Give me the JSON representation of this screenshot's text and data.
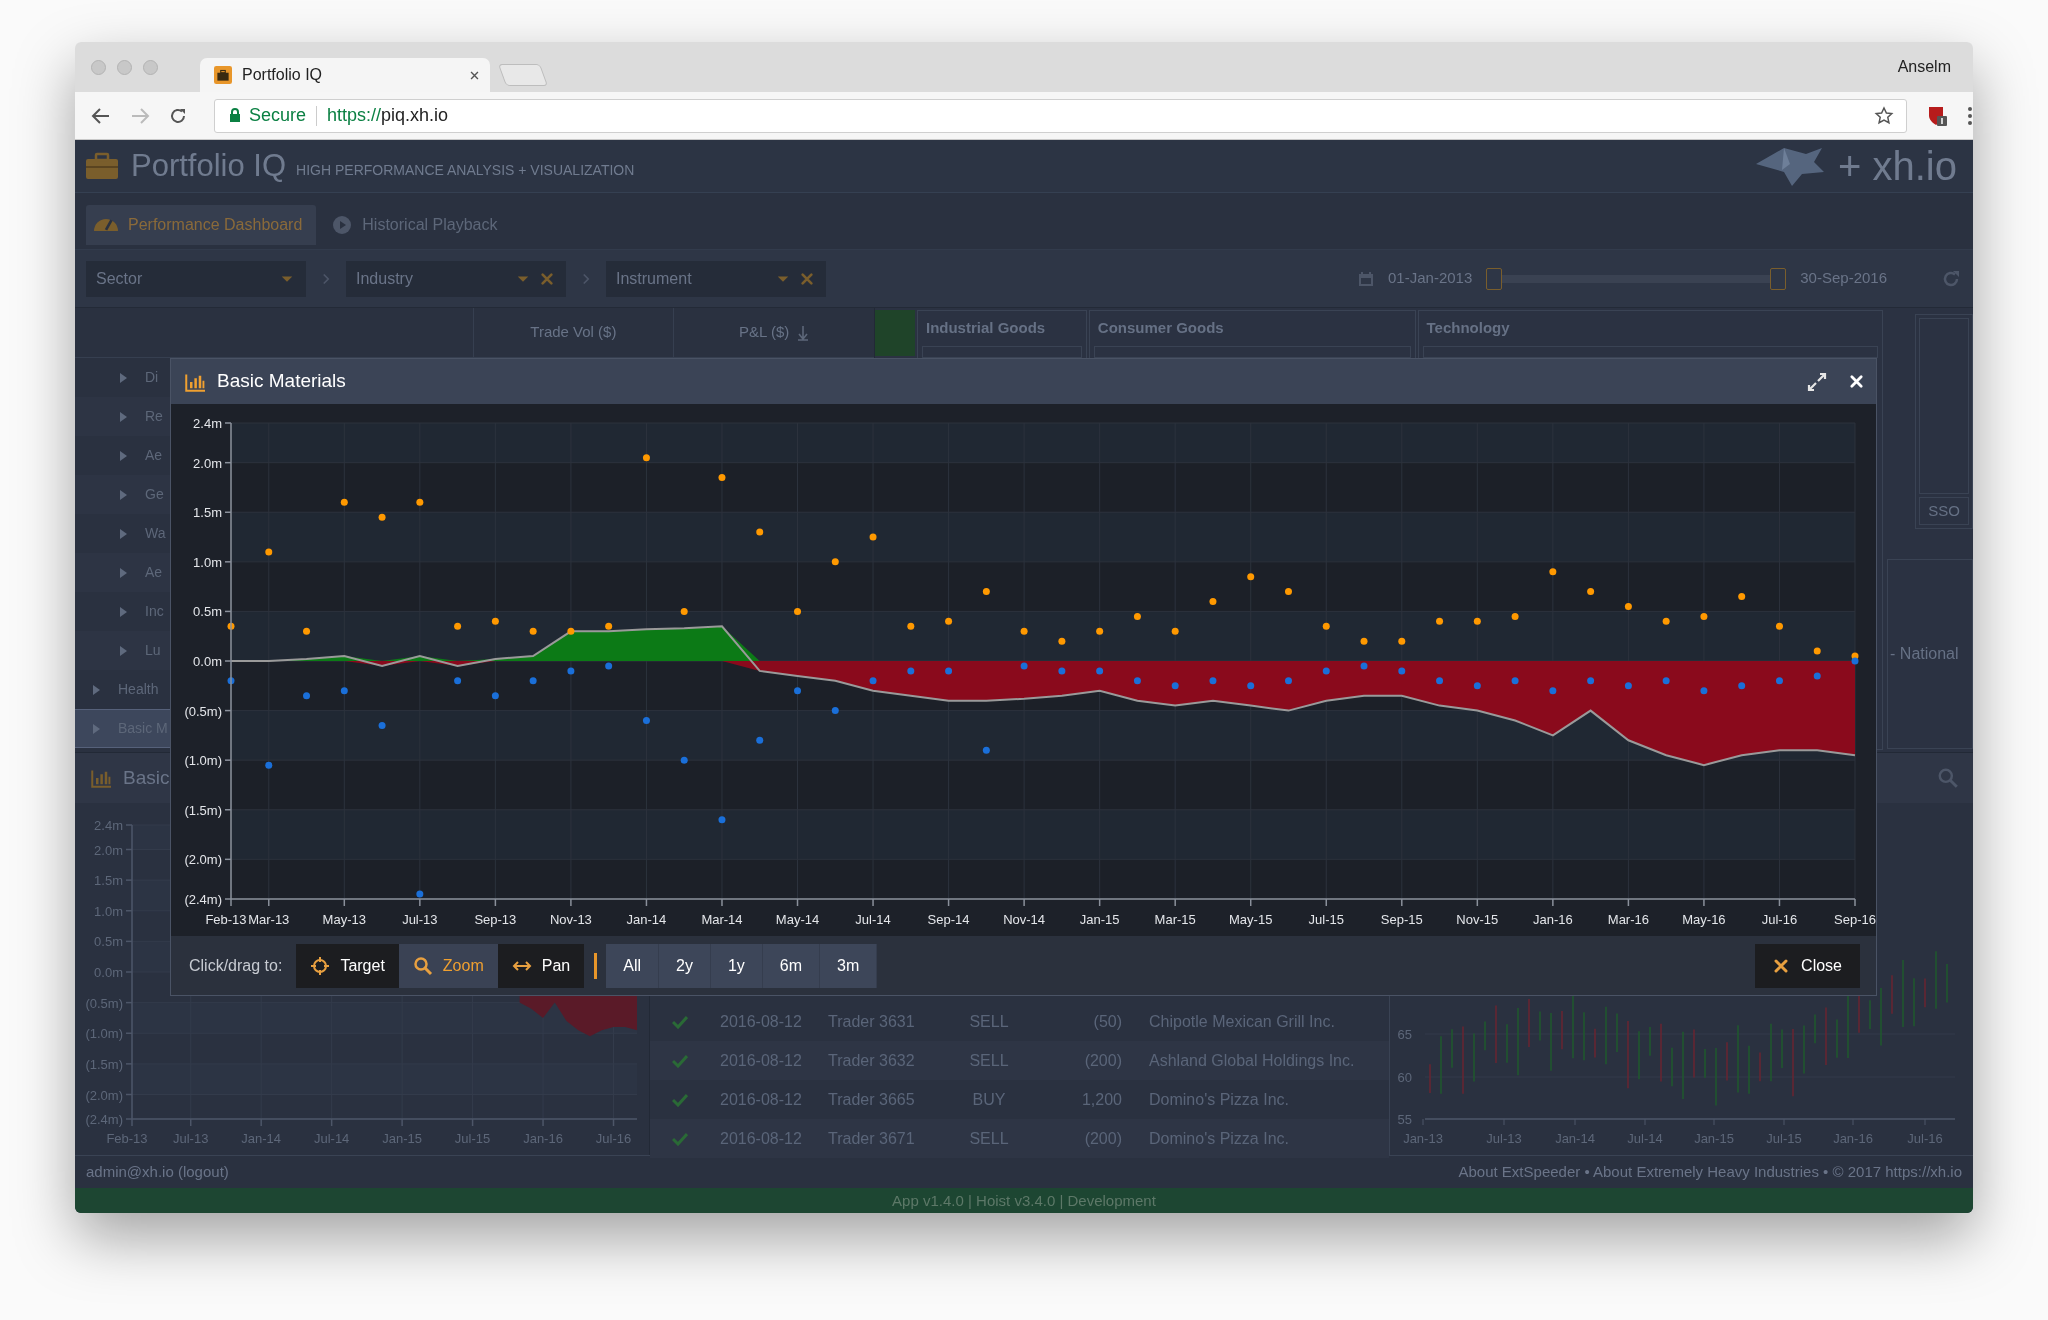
{
  "browser": {
    "tab_title": "Portfolio IQ",
    "profile": "Anselm",
    "security_label": "Secure",
    "url_scheme": "https://",
    "url_host": "piq.xh.io"
  },
  "app": {
    "title": "Portfolio IQ",
    "subtitle": "HIGH PERFORMANCE ANALYSIS + VISUALIZATION",
    "brand": "+ xh.io"
  },
  "nav_tabs": [
    {
      "label": "Performance Dashboard",
      "selected": true
    },
    {
      "label": "Historical Playback",
      "selected": false
    }
  ],
  "filters": [
    {
      "label": "Sector",
      "clearable": false
    },
    {
      "label": "Industry",
      "clearable": true
    },
    {
      "label": "Instrument",
      "clearable": true
    }
  ],
  "date_range": {
    "start": "01-Jan-2013",
    "end": "30-Sep-2016",
    "handles": [
      {
        "level": 0
      },
      {
        "level": 1
      }
    ]
  },
  "grid": {
    "columns": [
      "Trade Vol ($)",
      "P&L ($)"
    ],
    "rows": [
      {
        "label": "Di",
        "kind": "leaf",
        "selected": false
      },
      {
        "label": "Re",
        "kind": "leaf",
        "selected": false
      },
      {
        "label": "Ae",
        "kind": "leaf",
        "selected": false
      },
      {
        "label": "Ge",
        "kind": "leaf",
        "selected": false
      },
      {
        "label": "Wa",
        "kind": "leaf",
        "selected": false
      },
      {
        "label": "Ae",
        "kind": "leaf",
        "selected": false
      },
      {
        "label": "Inc",
        "kind": "leaf",
        "selected": false
      },
      {
        "label": "Lu",
        "kind": "leaf",
        "selected": false
      },
      {
        "label": "Health",
        "kind": "group",
        "selected": false
      },
      {
        "label": "Basic M",
        "kind": "group",
        "selected": true
      }
    ]
  },
  "treemap": {
    "groups": [
      "Industrial Goods",
      "Consumer Goods",
      "Technology"
    ],
    "cells": [
      "SSO",
      "- National"
    ]
  },
  "modal": {
    "title": "Basic Materials",
    "chart_data": {
      "type": "scatter",
      "grid": true,
      "categories": [
        "Feb-13",
        "Mar-13",
        null,
        "May-13",
        null,
        "Jul-13",
        null,
        "Sep-13",
        null,
        "Nov-13",
        null,
        "Jan-14",
        null,
        "Mar-14",
        null,
        "May-14",
        null,
        "Jul-14",
        null,
        "Sep-14",
        null,
        "Nov-14",
        null,
        "Jan-15",
        null,
        "Mar-15",
        null,
        "May-15",
        null,
        "Jul-15",
        null,
        "Sep-15",
        null,
        "Nov-15",
        null,
        "Jan-16",
        null,
        "Mar-16",
        null,
        "May-16",
        null,
        "Jul-16",
        null,
        "Sep-16"
      ],
      "ylim": [
        -2.4,
        2.4
      ],
      "yticks": [
        {
          "value": 2.4,
          "label": "2.4m"
        },
        {
          "value": 2,
          "label": "2.0m"
        },
        {
          "value": 1.5,
          "label": "1.5m"
        },
        {
          "value": 1,
          "label": "1.0m"
        },
        {
          "value": 0.5,
          "label": "0.5m"
        },
        {
          "value": 0,
          "label": "0.0m"
        },
        {
          "value": -0.5,
          "label": "(0.5m)"
        },
        {
          "value": -1,
          "label": "(1.0m)"
        },
        {
          "value": -1.5,
          "label": "(1.5m)"
        },
        {
          "value": -2,
          "label": "(2.0m)"
        },
        {
          "value": -2.4,
          "label": "(2.4m)"
        }
      ],
      "series": [
        {
          "type": "area",
          "color": "#0c7a16",
          "values": [
            0,
            0,
            0.02,
            0.05,
            0,
            0.05,
            0,
            0.02,
            0.05,
            0.3,
            0.3,
            0.32,
            0.33,
            0.35,
            0,
            0,
            0,
            0,
            0,
            0,
            0,
            0,
            0,
            0,
            0,
            0,
            0,
            0,
            0,
            0,
            0,
            0,
            0,
            0,
            0,
            0,
            0,
            0,
            0,
            0,
            0,
            0,
            0,
            0
          ]
        },
        {
          "type": "area",
          "color": "#8a0a1c",
          "values": [
            0,
            0,
            0,
            0,
            -0.05,
            0,
            -0.05,
            0,
            0,
            0,
            0,
            0,
            0,
            0,
            -0.1,
            -0.15,
            -0.2,
            -0.3,
            -0.35,
            -0.4,
            -0.4,
            -0.38,
            -0.35,
            -0.3,
            -0.4,
            -0.45,
            -0.4,
            -0.45,
            -0.5,
            -0.4,
            -0.35,
            -0.35,
            -0.45,
            -0.5,
            -0.6,
            -0.75,
            -0.5,
            -0.8,
            -0.95,
            -1.05,
            -0.95,
            -0.9,
            -0.9,
            -0.95
          ]
        },
        {
          "type": "line",
          "color": "#9a9a9a",
          "values": [
            0,
            0,
            0.02,
            0.05,
            -0.05,
            0.05,
            -0.05,
            0.02,
            0.05,
            0.3,
            0.3,
            0.32,
            0.33,
            0.35,
            -0.1,
            -0.15,
            -0.2,
            -0.3,
            -0.35,
            -0.4,
            -0.4,
            -0.38,
            -0.35,
            -0.3,
            -0.4,
            -0.45,
            -0.4,
            -0.45,
            -0.5,
            -0.4,
            -0.35,
            -0.35,
            -0.45,
            -0.5,
            -0.6,
            -0.75,
            -0.5,
            -0.8,
            -0.95,
            -1.05,
            -0.95,
            -0.9,
            -0.9,
            -0.95
          ]
        },
        {
          "type": "scatter",
          "color": "#ff9900",
          "values": [
            0.35,
            1.1,
            0.3,
            1.6,
            1.45,
            1.6,
            0.35,
            0.4,
            0.3,
            0.3,
            0.35,
            2.05,
            0.5,
            1.85,
            1.3,
            0.5,
            1.0,
            1.25,
            0.35,
            0.4,
            0.7,
            0.3,
            0.2,
            0.3,
            0.45,
            0.3,
            0.6,
            0.85,
            0.7,
            0.35,
            0.2,
            0.2,
            0.4,
            0.4,
            0.45,
            0.9,
            0.7,
            0.55,
            0.4,
            0.45,
            0.65,
            0.35,
            0.1,
            0.05
          ]
        },
        {
          "type": "scatter",
          "color": "#1a6fd9",
          "values": [
            -0.2,
            -1.05,
            -0.35,
            -0.3,
            -0.65,
            -2.35,
            -0.2,
            -0.35,
            -0.2,
            -0.1,
            -0.05,
            -0.6,
            -1.0,
            -1.6,
            -0.8,
            -0.3,
            -0.5,
            -0.2,
            -0.1,
            -0.1,
            -0.9,
            -0.05,
            -0.1,
            -0.1,
            -0.2,
            -0.25,
            -0.2,
            -0.25,
            -0.2,
            -0.1,
            -0.05,
            -0.1,
            -0.2,
            -0.25,
            -0.2,
            -0.3,
            -0.2,
            -0.25,
            -0.2,
            -0.3,
            -0.25,
            -0.2,
            -0.15,
            0
          ]
        }
      ]
    },
    "toolbar_label": "Click/drag to:",
    "modes": [
      {
        "label": "Target",
        "selected": false
      },
      {
        "label": "Zoom",
        "selected": true
      },
      {
        "label": "Pan",
        "selected": false
      }
    ],
    "ranges": [
      "All",
      "2y",
      "1y",
      "6m",
      "3m"
    ],
    "close_label": "Close"
  },
  "chart_panel": {
    "title": "Basic",
    "chart_data": {
      "type": "area",
      "grid": true,
      "categories": [
        "Feb-13",
        null,
        null,
        null,
        null,
        "Jul-13",
        null,
        null,
        null,
        null,
        null,
        "Jan-14",
        null,
        null,
        null,
        null,
        null,
        "Jul-14",
        null,
        null,
        null,
        null,
        null,
        "Jan-15",
        null,
        null,
        null,
        null,
        null,
        "Jul-15",
        null,
        null,
        null,
        null,
        null,
        "Jan-16",
        null,
        null,
        null,
        null,
        null,
        "Jul-16",
        null,
        null
      ],
      "ylim": [
        -2.4,
        2.4
      ],
      "yticks": [
        {
          "value": 2.4,
          "label": "2.4m"
        },
        {
          "value": 2,
          "label": "2.0m"
        },
        {
          "value": 1.5,
          "label": "1.5m"
        },
        {
          "value": 1,
          "label": "1.0m"
        },
        {
          "value": 0.5,
          "label": "0.5m"
        },
        {
          "value": 0,
          "label": "0.0m"
        },
        {
          "value": -0.5,
          "label": "(0.5m)"
        },
        {
          "value": -1,
          "label": "(1.0m)"
        },
        {
          "value": -1.5,
          "label": "(1.5m)"
        },
        {
          "value": -2,
          "label": "(2.0m)"
        },
        {
          "value": -2.4,
          "label": "(2.4m)"
        }
      ],
      "series": [
        {
          "type": "area",
          "color": "#5a1a28",
          "values": [
            null,
            null,
            null,
            null,
            null,
            null,
            null,
            null,
            null,
            null,
            null,
            null,
            null,
            null,
            null,
            null,
            null,
            null,
            null,
            null,
            null,
            null,
            null,
            null,
            null,
            null,
            null,
            null,
            null,
            null,
            null,
            null,
            null,
            -0.5,
            -0.6,
            -0.75,
            -0.5,
            -0.8,
            -0.95,
            -1.05,
            -0.95,
            -0.9,
            -0.9,
            -0.95
          ]
        }
      ]
    }
  },
  "trades": {
    "rows": [
      {
        "date": "2016-08-12",
        "trader": "Trader 3631",
        "side": "SELL",
        "quantity": "(50)",
        "instrument": "Chipotle Mexican Grill Inc."
      },
      {
        "date": "2016-08-12",
        "trader": "Trader 3632",
        "side": "SELL",
        "quantity": "(200)",
        "instrument": "Ashland Global Holdings Inc."
      },
      {
        "date": "2016-08-12",
        "trader": "Trader 3665",
        "side": "BUY",
        "quantity": "1,200",
        "instrument": "Domino's Pizza Inc."
      },
      {
        "date": "2016-08-12",
        "trader": "Trader 3671",
        "side": "SELL",
        "quantity": "(200)",
        "instrument": "Domino's Pizza Inc."
      }
    ]
  },
  "price_chart": {
    "yticks": [
      "65",
      "60",
      "55"
    ],
    "xticks": [
      "Jan-13",
      "Jul-13",
      "Jan-14",
      "Jul-14",
      "Jan-15",
      "Jul-15",
      "Jan-16",
      "Jul-16"
    ]
  },
  "footer": {
    "user": "admin@xh.io (logout)",
    "links": "About ExtSpeeder • About Extremely Heavy Industries • © 2017 https://xh.io"
  },
  "version_bar": "App v1.4.0 | Hoist v3.4.0 | Development"
}
